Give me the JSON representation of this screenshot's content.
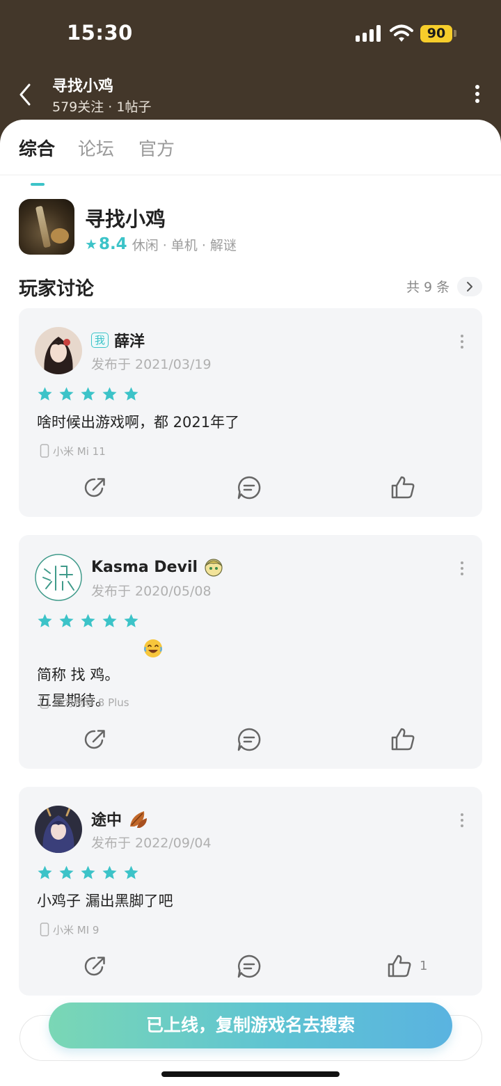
{
  "status_bar": {
    "time": "15:30",
    "battery": "90"
  },
  "header": {
    "title": "寻找小鸡",
    "subtitle": "579关注 · 1帖子"
  },
  "tabs": [
    {
      "label": "综合",
      "active": true
    },
    {
      "label": "论坛",
      "active": false
    },
    {
      "label": "官方",
      "active": false
    }
  ],
  "game": {
    "name": "寻找小鸡",
    "rating": "8.4",
    "tags": "休闲 · 单机 · 解谜"
  },
  "discussion": {
    "title": "玩家讨论",
    "count": "共 9 条"
  },
  "posts": [
    {
      "badge": "我",
      "user": "薛洋",
      "date": "发布于 2021/03/19",
      "stars": 5,
      "content": "啥时候出游戏啊，都 2021年了",
      "device": "小米 Mi 11",
      "likes": ""
    },
    {
      "user": "Kasma Devil",
      "date": "发布于 2020/05/08",
      "stars": 5,
      "content": "简称  找   鸡。\n五星期待。",
      "device": "华为畅享 8 Plus",
      "likes": ""
    },
    {
      "user": "途中",
      "date": "发布于 2022/09/04",
      "stars": 5,
      "content": "小鸡子 漏出黑脚了吧",
      "device": "小米 MI 9",
      "likes": "1"
    }
  ],
  "cta": {
    "label": "已上线，复制游戏名去搜索"
  },
  "colors": {
    "accent": "#3cc3c8",
    "header_bg": "#43372a",
    "card_bg": "#f4f5f7"
  }
}
